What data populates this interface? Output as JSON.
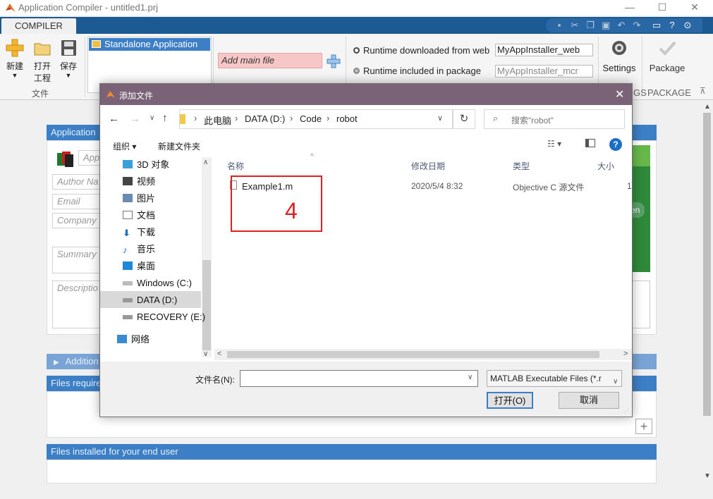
{
  "window": {
    "title": "Application Compiler - untitled1.prj",
    "controls": [
      "—",
      "☐",
      "✕"
    ]
  },
  "ribbon": {
    "tab": "COMPILER",
    "file_group": {
      "label": "文件",
      "new_label": "新建",
      "open_label_1": "打开",
      "open_label_2": "工程",
      "save_label": "保存"
    },
    "app_type": {
      "selected": "Standalone Application"
    },
    "main_file": {
      "placeholder": "Add main file"
    },
    "runtime": {
      "web_label": "Runtime downloaded from web",
      "web_value": "MyAppInstaller_web",
      "package_label": "Runtime included in package",
      "package_value": "MyAppInstaller_mcr"
    },
    "settings_label": "Settings",
    "package_label": "Package",
    "section_partial": "GS",
    "section_package": "PACKAGE"
  },
  "main": {
    "app_info_header": "Application",
    "app_name_placeholder": "App",
    "author_placeholder": "Author Na",
    "email_placeholder": "Email",
    "company_placeholder": "Company",
    "summary_placeholder": "Summary",
    "description_placeholder": "Descriptio",
    "splash_button_partial": "en",
    "additional_header": "Addition",
    "files_required_header": "Files require",
    "files_installed_header": "Files installed for your end user"
  },
  "dialog": {
    "title": "添加文件",
    "address": {
      "segments": [
        "此电脑",
        "DATA (D:)",
        "Code",
        "robot"
      ]
    },
    "search_placeholder": "搜索\"robot\"",
    "toolbar": {
      "organize": "组织 ▾",
      "new_folder": "新建文件夹"
    },
    "nav_items": [
      {
        "label": "3D 对象",
        "icon": "cube-icon"
      },
      {
        "label": "视频",
        "icon": "video-icon"
      },
      {
        "label": "图片",
        "icon": "picture-icon"
      },
      {
        "label": "文档",
        "icon": "document-icon"
      },
      {
        "label": "下载",
        "icon": "download-icon"
      },
      {
        "label": "音乐",
        "icon": "music-icon"
      },
      {
        "label": "桌面",
        "icon": "desktop-icon"
      },
      {
        "label": "Windows (C:)",
        "icon": "drive-icon"
      },
      {
        "label": "DATA (D:)",
        "icon": "drive-icon"
      },
      {
        "label": "RECOVERY (E:)",
        "icon": "drive-icon"
      },
      {
        "label": "网络",
        "icon": "network-icon"
      }
    ],
    "columns": {
      "name": "名称",
      "modified": "修改日期",
      "type": "类型",
      "size": "大小"
    },
    "files": [
      {
        "name": "Example1.m",
        "modified": "2020/5/4 8:32",
        "type": "Objective C 源文件",
        "size": "1"
      }
    ],
    "annotation": "4",
    "filename_label": "文件名(N):",
    "filename_value": "",
    "filter": "MATLAB Executable Files (*.r",
    "open_button": "打开(O)",
    "cancel_button": "取消"
  },
  "colors": {
    "ribbon_blue": "#1c5a93",
    "section_blue": "#3c7fc6",
    "dialog_title": "#7a6277",
    "annotation_red": "#e02020",
    "main_file_pink": "#f7c7c7"
  }
}
